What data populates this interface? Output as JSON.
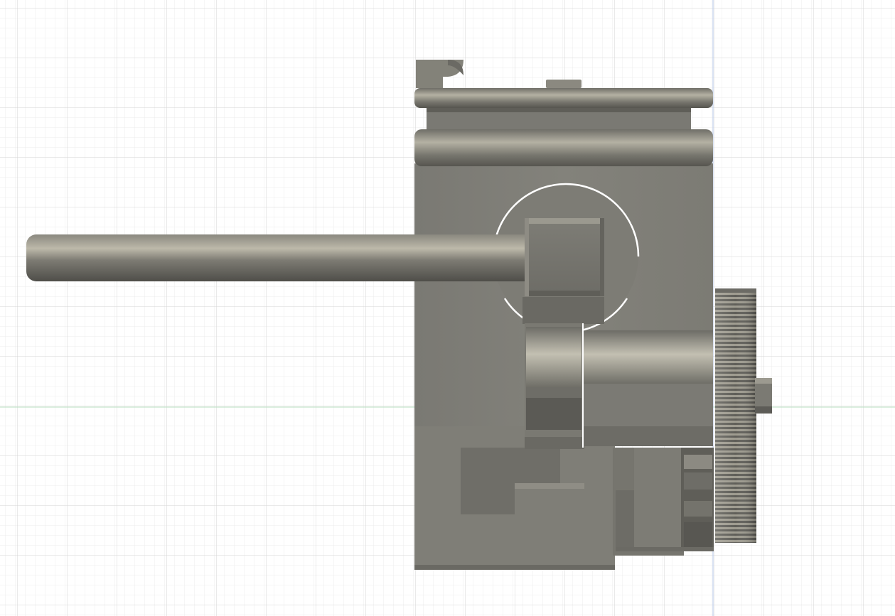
{
  "viewport": {
    "view": "front",
    "background": "#ffffff",
    "grid_minor_color": "#ececec",
    "grid_major_color": "#d7d7d7",
    "x_axis_color": "#b8e2c2",
    "y_axis_color": "#b6c7ea",
    "model_base_color": "#807f78",
    "model_shadow_color": "#5e5d57",
    "model_highlight_color": "#b6b3a6",
    "edge_highlight_color": "#ffffff"
  },
  "model": {
    "parts": [
      "housing",
      "top-clamp",
      "rod",
      "square-block",
      "pivot-cutout",
      "roller",
      "lower-base",
      "motor-block",
      "spur-gear",
      "shaft-nut"
    ]
  }
}
